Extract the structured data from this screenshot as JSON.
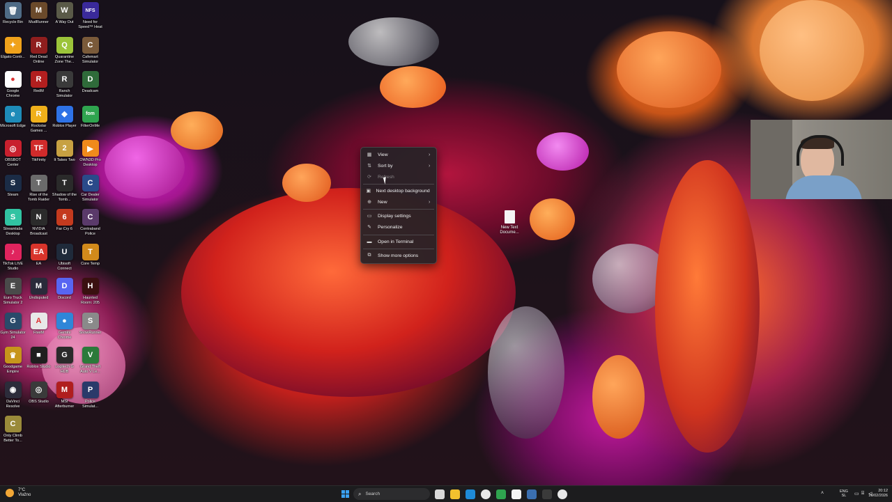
{
  "desktop": {
    "icons": [
      {
        "label": "Recycle Bin",
        "glyph": "🗑",
        "color": "#4f6b86"
      },
      {
        "label": "MudRunner",
        "glyph": "M",
        "color": "#6b4a2b"
      },
      {
        "label": "A Way Out",
        "glyph": "W",
        "color": "#5a5a48"
      },
      {
        "label": "Need for Speed™ Heat",
        "glyph": "NFS",
        "color": "#3a2a9a"
      },
      {
        "label": "Elgato Contr...",
        "glyph": "✦",
        "color": "#f0a21b"
      },
      {
        "label": "Red Dead Online",
        "glyph": "R",
        "color": "#8f1e1e"
      },
      {
        "label": "Quarantine Zone The...",
        "glyph": "Q",
        "color": "#9cc43a"
      },
      {
        "label": "Cafemart Simulator",
        "glyph": "C",
        "color": "#7a5a3a"
      },
      {
        "label": "Google Chrome",
        "glyph": "●",
        "color": "#ffffff"
      },
      {
        "label": "RedM",
        "glyph": "R",
        "color": "#b21f1f"
      },
      {
        "label": "Ranch Simulator",
        "glyph": "R",
        "color": "#3a3a3a"
      },
      {
        "label": "Deadcam",
        "glyph": "D",
        "color": "#2f6b3a"
      },
      {
        "label": "Microsoft Edge",
        "glyph": "e",
        "color": "#1e8bb8"
      },
      {
        "label": "Rockstar Games ...",
        "glyph": "R",
        "color": "#f0b01b"
      },
      {
        "label": "Roblox Player",
        "glyph": "◆",
        "color": "#2e72e6"
      },
      {
        "label": "FilterOnMe",
        "glyph": "fom",
        "color": "#2fa44f"
      },
      {
        "label": "OBSBOT Center",
        "glyph": "◎",
        "color": "#c8202e"
      },
      {
        "label": "TikFinity",
        "glyph": "TF",
        "color": "#d12b2b"
      },
      {
        "label": "It Takes Two",
        "glyph": "2",
        "color": "#c7a142"
      },
      {
        "label": "OWN3D Pro Desktop",
        "glyph": "▶",
        "color": "#f08a1b"
      },
      {
        "label": "Steam",
        "glyph": "S",
        "color": "#1b2c46"
      },
      {
        "label": "Rise of the Tomb Raider",
        "glyph": "T",
        "color": "#6b6b6b"
      },
      {
        "label": "Shadow of the Tomb...",
        "glyph": "T",
        "color": "#2a2a2a"
      },
      {
        "label": "Car Dealer Simulator",
        "glyph": "C",
        "color": "#2a4a8a"
      },
      {
        "label": "Streamlabs Desktop",
        "glyph": "S",
        "color": "#31c3a2"
      },
      {
        "label": "NVIDIA Broadcast",
        "glyph": "N",
        "color": "#2b2b2b"
      },
      {
        "label": "Far Cry 6",
        "glyph": "6",
        "color": "#c43a1e"
      },
      {
        "label": "Contraband Police",
        "glyph": "C",
        "color": "#5a3a6a"
      },
      {
        "label": "TikTok LIVE Studio",
        "glyph": "♪",
        "color": "#e0245e"
      },
      {
        "label": "EA",
        "glyph": "EA",
        "color": "#d8342b"
      },
      {
        "label": "Ubisoft Connect",
        "glyph": "U",
        "color": "#1f2a3a"
      },
      {
        "label": "Core Temp",
        "glyph": "T",
        "color": "#d28a1b"
      },
      {
        "label": "Euro Truck Simulator 2",
        "glyph": "E",
        "color": "#4a4a4a"
      },
      {
        "label": "Undisputed",
        "glyph": "M",
        "color": "#2a2a3a"
      },
      {
        "label": "Discord",
        "glyph": "D",
        "color": "#5865f2"
      },
      {
        "label": "Haunted Room: 205",
        "glyph": "H",
        "color": "#3a1010"
      },
      {
        "label": "Gym Simulator 24",
        "glyph": "G",
        "color": "#2a4a6a"
      },
      {
        "label": "FiveM",
        "glyph": "A",
        "color": "#e8e8e8"
      },
      {
        "label": "Gemini Chrome",
        "glyph": "●",
        "color": "#2f86d8"
      },
      {
        "label": "SnowRunner",
        "glyph": "S",
        "color": "#8a8a8a"
      },
      {
        "label": "Goodgame Empire",
        "glyph": "♛",
        "color": "#c7951b"
      },
      {
        "label": "Roblox Studio",
        "glyph": "■",
        "color": "#1f1f1f"
      },
      {
        "label": "Logitech G HUB",
        "glyph": "G",
        "color": "#2a2a2a"
      },
      {
        "label": "Grand Theft Auto V Le...",
        "glyph": "V",
        "color": "#2b7a3a"
      },
      {
        "label": "DaVinci Resolve",
        "glyph": "◉",
        "color": "#2c2c3a"
      },
      {
        "label": "OBS Studio",
        "glyph": "◎",
        "color": "#3a3a3a"
      },
      {
        "label": "MSI Afterburner",
        "glyph": "M",
        "color": "#b01e1e"
      },
      {
        "label": "Police Simulat...",
        "glyph": "P",
        "color": "#2a3a6a"
      },
      {
        "label": "Only Climb Better To...",
        "glyph": "C",
        "color": "#9a8a3a"
      }
    ],
    "file": {
      "label": "New Text Docume..."
    }
  },
  "context_menu": {
    "items": [
      {
        "icon": "▦",
        "label": "View",
        "submenu": "›"
      },
      {
        "icon": "⇅",
        "label": "Sort by",
        "submenu": "›"
      },
      {
        "icon": "⟳",
        "label": "Refresh",
        "submenu": ""
      },
      {
        "icon": "▣",
        "label": "Next desktop background",
        "submenu": ""
      },
      {
        "icon": "⊕",
        "label": "New",
        "submenu": "›"
      },
      {
        "icon": "▭",
        "label": "Display settings",
        "submenu": ""
      },
      {
        "icon": "✎",
        "label": "Personalize",
        "submenu": ""
      },
      {
        "icon": "▬",
        "label": "Open in Terminal",
        "submenu": ""
      },
      {
        "icon": "⧉",
        "label": "Show more options",
        "submenu": ""
      }
    ]
  },
  "taskbar": {
    "weather": {
      "temp": "7°C",
      "condition": "Vlažno"
    },
    "search_label": "Search",
    "pinned_apps": [
      {
        "name": "task-view",
        "color": "#d8d8d8"
      },
      {
        "name": "file-explorer",
        "color": "#f2c12e"
      },
      {
        "name": "edge",
        "color": "#1e8bd8"
      },
      {
        "name": "chrome",
        "color": "#e8e8e8"
      },
      {
        "name": "xbox",
        "color": "#2fa44f"
      },
      {
        "name": "store",
        "color": "#f5f5f5"
      },
      {
        "name": "steam",
        "color": "#3b6fb0"
      },
      {
        "name": "obs",
        "color": "#3a3a3a"
      },
      {
        "name": "chrome-2",
        "color": "#e8e8e8"
      }
    ],
    "tray": {
      "lang_top": "ENG",
      "lang_bottom": "SL",
      "time": "20:12",
      "date": "26/02/2026"
    }
  }
}
